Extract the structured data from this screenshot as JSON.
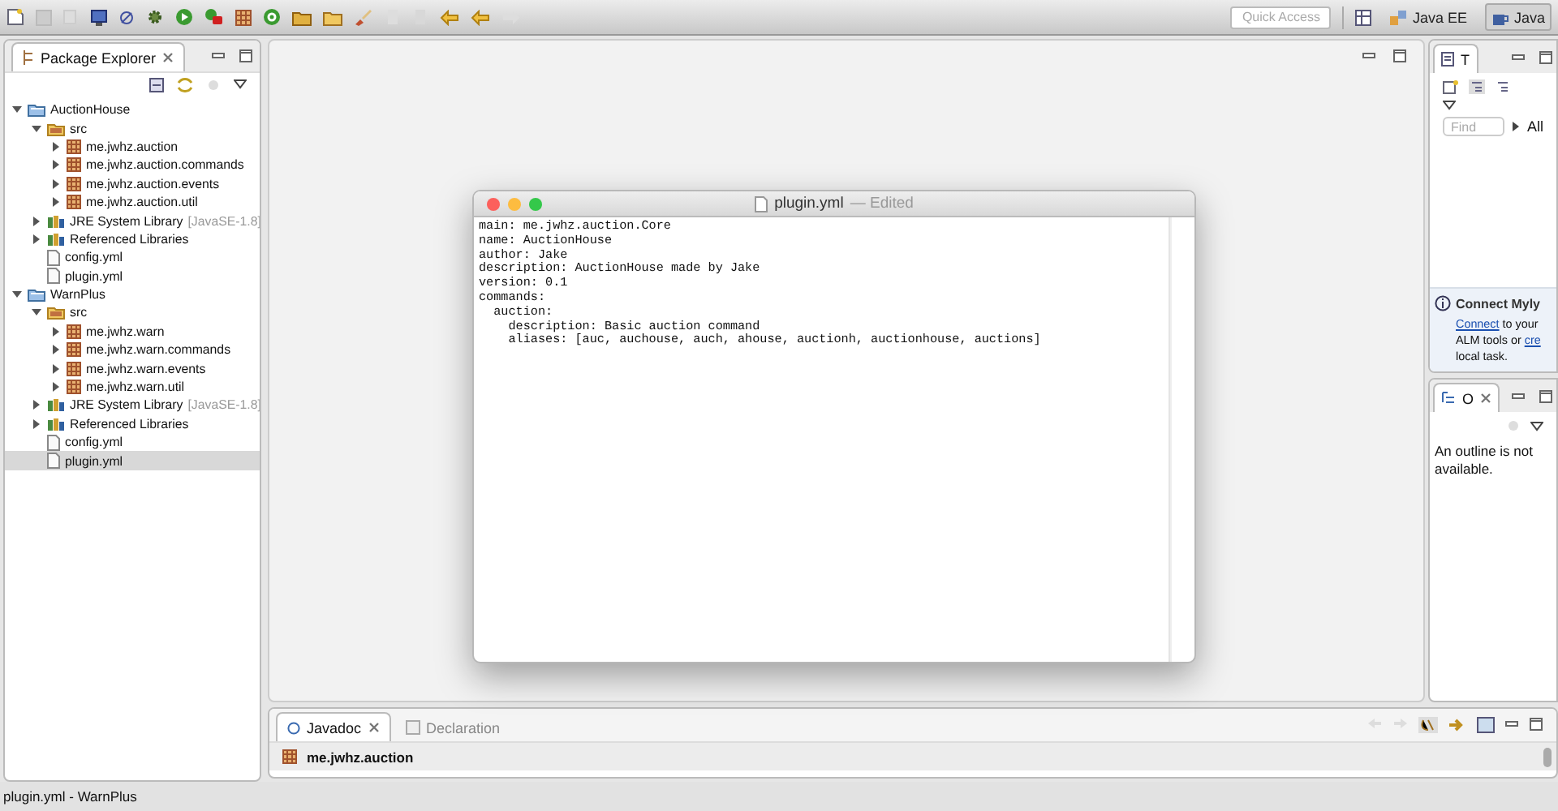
{
  "toolbar": {
    "quick_access": {
      "placeholder": "Quick Access"
    },
    "perspectives": [
      {
        "label": "Java EE",
        "selected": false
      },
      {
        "label": "Java",
        "selected": true
      }
    ]
  },
  "package_explorer": {
    "tab": {
      "label": "Package Explorer",
      "selected": true
    },
    "tree": [
      {
        "label": "AuctionHouse",
        "kind": "project",
        "expanded": true,
        "selected": false,
        "children": [
          {
            "label": "src",
            "kind": "folder",
            "expanded": true,
            "selected": false,
            "children": [
              {
                "label": "me.jwhz.auction",
                "kind": "package",
                "expanded": false,
                "selected": false
              },
              {
                "label": "me.jwhz.auction.commands",
                "kind": "package",
                "expanded": false,
                "selected": false
              },
              {
                "label": "me.jwhz.auction.events",
                "kind": "package",
                "expanded": false,
                "selected": false
              },
              {
                "label": "me.jwhz.auction.util",
                "kind": "package",
                "expanded": false,
                "selected": false
              }
            ]
          },
          {
            "label": "JRE System Library",
            "decoration": "[JavaSE-1.8]",
            "kind": "library",
            "expanded": false,
            "selected": false
          },
          {
            "label": "Referenced Libraries",
            "kind": "library",
            "expanded": false,
            "selected": false
          },
          {
            "label": "config.yml",
            "kind": "file",
            "selected": false
          },
          {
            "label": "plugin.yml",
            "kind": "file",
            "selected": false
          }
        ]
      },
      {
        "label": "WarnPlus",
        "kind": "project",
        "expanded": true,
        "selected": false,
        "children": [
          {
            "label": "src",
            "kind": "folder",
            "expanded": true,
            "selected": false,
            "children": [
              {
                "label": "me.jwhz.warn",
                "kind": "package",
                "expanded": false,
                "selected": false
              },
              {
                "label": "me.jwhz.warn.commands",
                "kind": "package",
                "expanded": false,
                "selected": false
              },
              {
                "label": "me.jwhz.warn.events",
                "kind": "package",
                "expanded": false,
                "selected": false
              },
              {
                "label": "me.jwhz.warn.util",
                "kind": "package",
                "expanded": false,
                "selected": false
              }
            ]
          },
          {
            "label": "JRE System Library",
            "decoration": "[JavaSE-1.8]",
            "kind": "library",
            "expanded": false,
            "selected": false
          },
          {
            "label": "Referenced Libraries",
            "kind": "library",
            "expanded": false,
            "selected": false
          },
          {
            "label": "config.yml",
            "kind": "file",
            "selected": false
          },
          {
            "label": "plugin.yml",
            "kind": "file",
            "selected": true
          }
        ]
      }
    ]
  },
  "editor_window": {
    "title": "plugin.yml",
    "status": "— Edited",
    "lines": [
      "main: me.jwhz.auction.Core",
      "name: AuctionHouse",
      "author: Jake",
      "description: AuctionHouse made by Jake",
      "version: 0.1",
      "commands:",
      "  auction:",
      "    description: Basic auction command",
      "    aliases: [auc, auchouse, auch, ahouse, auctionh, auctionhouse, auctions]"
    ]
  },
  "task_list": {
    "tab": {
      "label": "T",
      "selected": true
    },
    "find": {
      "placeholder": "Find"
    },
    "filter": "All",
    "connect": {
      "title": "Connect Myly",
      "link": "Connect",
      "text_1": " to your",
      "text_2": "ALM tools or ",
      "link_2": "cre",
      "text_3": "local task."
    }
  },
  "outline": {
    "tab": {
      "label": "O",
      "selected": true
    },
    "message": "An outline is not available."
  },
  "bottom_panel": {
    "tabs": [
      {
        "label": "Javadoc",
        "selected": true
      },
      {
        "label": "Declaration",
        "selected": false
      }
    ],
    "content": "me.jwhz.auction"
  },
  "status_bar": "plugin.yml - WarnPlus"
}
